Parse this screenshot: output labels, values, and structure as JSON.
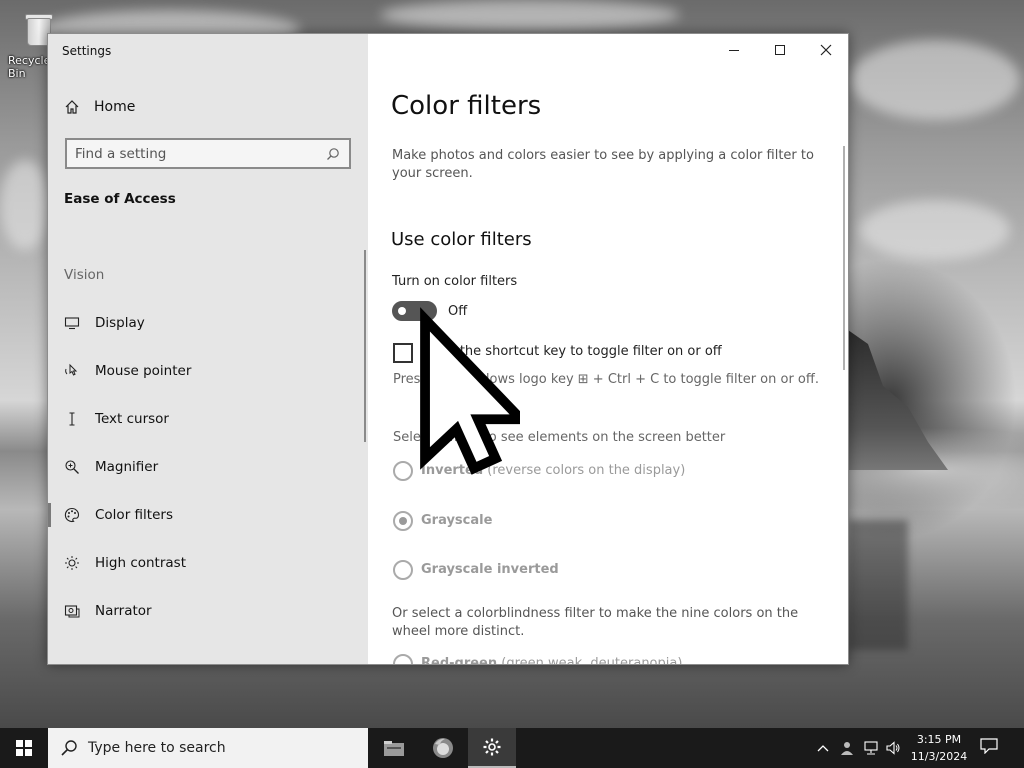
{
  "desktop": {
    "recycle_bin_label": "Recycle Bin"
  },
  "window": {
    "title": "Settings",
    "controls": {
      "minimize": "minimize",
      "maximize": "maximize",
      "close": "close"
    }
  },
  "sidebar": {
    "home_label": "Home",
    "search_placeholder": "Find a setting",
    "section_title": "Ease of Access",
    "group_label": "Vision",
    "items": [
      {
        "label": "Display",
        "icon": "display-icon"
      },
      {
        "label": "Mouse pointer",
        "icon": "mouse-pointer-icon"
      },
      {
        "label": "Text cursor",
        "icon": "text-cursor-icon"
      },
      {
        "label": "Magnifier",
        "icon": "magnifier-icon"
      },
      {
        "label": "Color filters",
        "icon": "color-filters-icon",
        "selected": true
      },
      {
        "label": "High contrast",
        "icon": "high-contrast-icon"
      },
      {
        "label": "Narrator",
        "icon": "narrator-icon"
      }
    ]
  },
  "main": {
    "title": "Color filters",
    "description": "Make photos and colors easier to see by applying a color filter to your screen.",
    "use_filters_title": "Use color filters",
    "toggle_label": "Turn on color filters",
    "toggle_state": "Off",
    "toggle_on": false,
    "shortcut_checkbox_label": "Allow the shortcut key to toggle filter on or off",
    "shortcut_hint": "Press the Windows logo key ⊞ + Ctrl + C to toggle filter on or off.",
    "select_filter_label": "Select a filter to see elements on the screen better",
    "filters": [
      {
        "name": "Inverted",
        "detail": "(reverse colors on the display)",
        "checked": false
      },
      {
        "name": "Grayscale",
        "detail": "",
        "checked": true
      },
      {
        "name": "Grayscale inverted",
        "detail": "",
        "checked": false
      }
    ],
    "colorblind_label": "Or select a colorblindness filter to make the nine colors on the wheel more distinct.",
    "colorblind_first": {
      "name": "Red-green",
      "detail": "(green weak, deuteranopia)"
    }
  },
  "taskbar": {
    "search_placeholder": "Type here to search",
    "time": "3:15 PM",
    "date": "11/3/2024"
  }
}
